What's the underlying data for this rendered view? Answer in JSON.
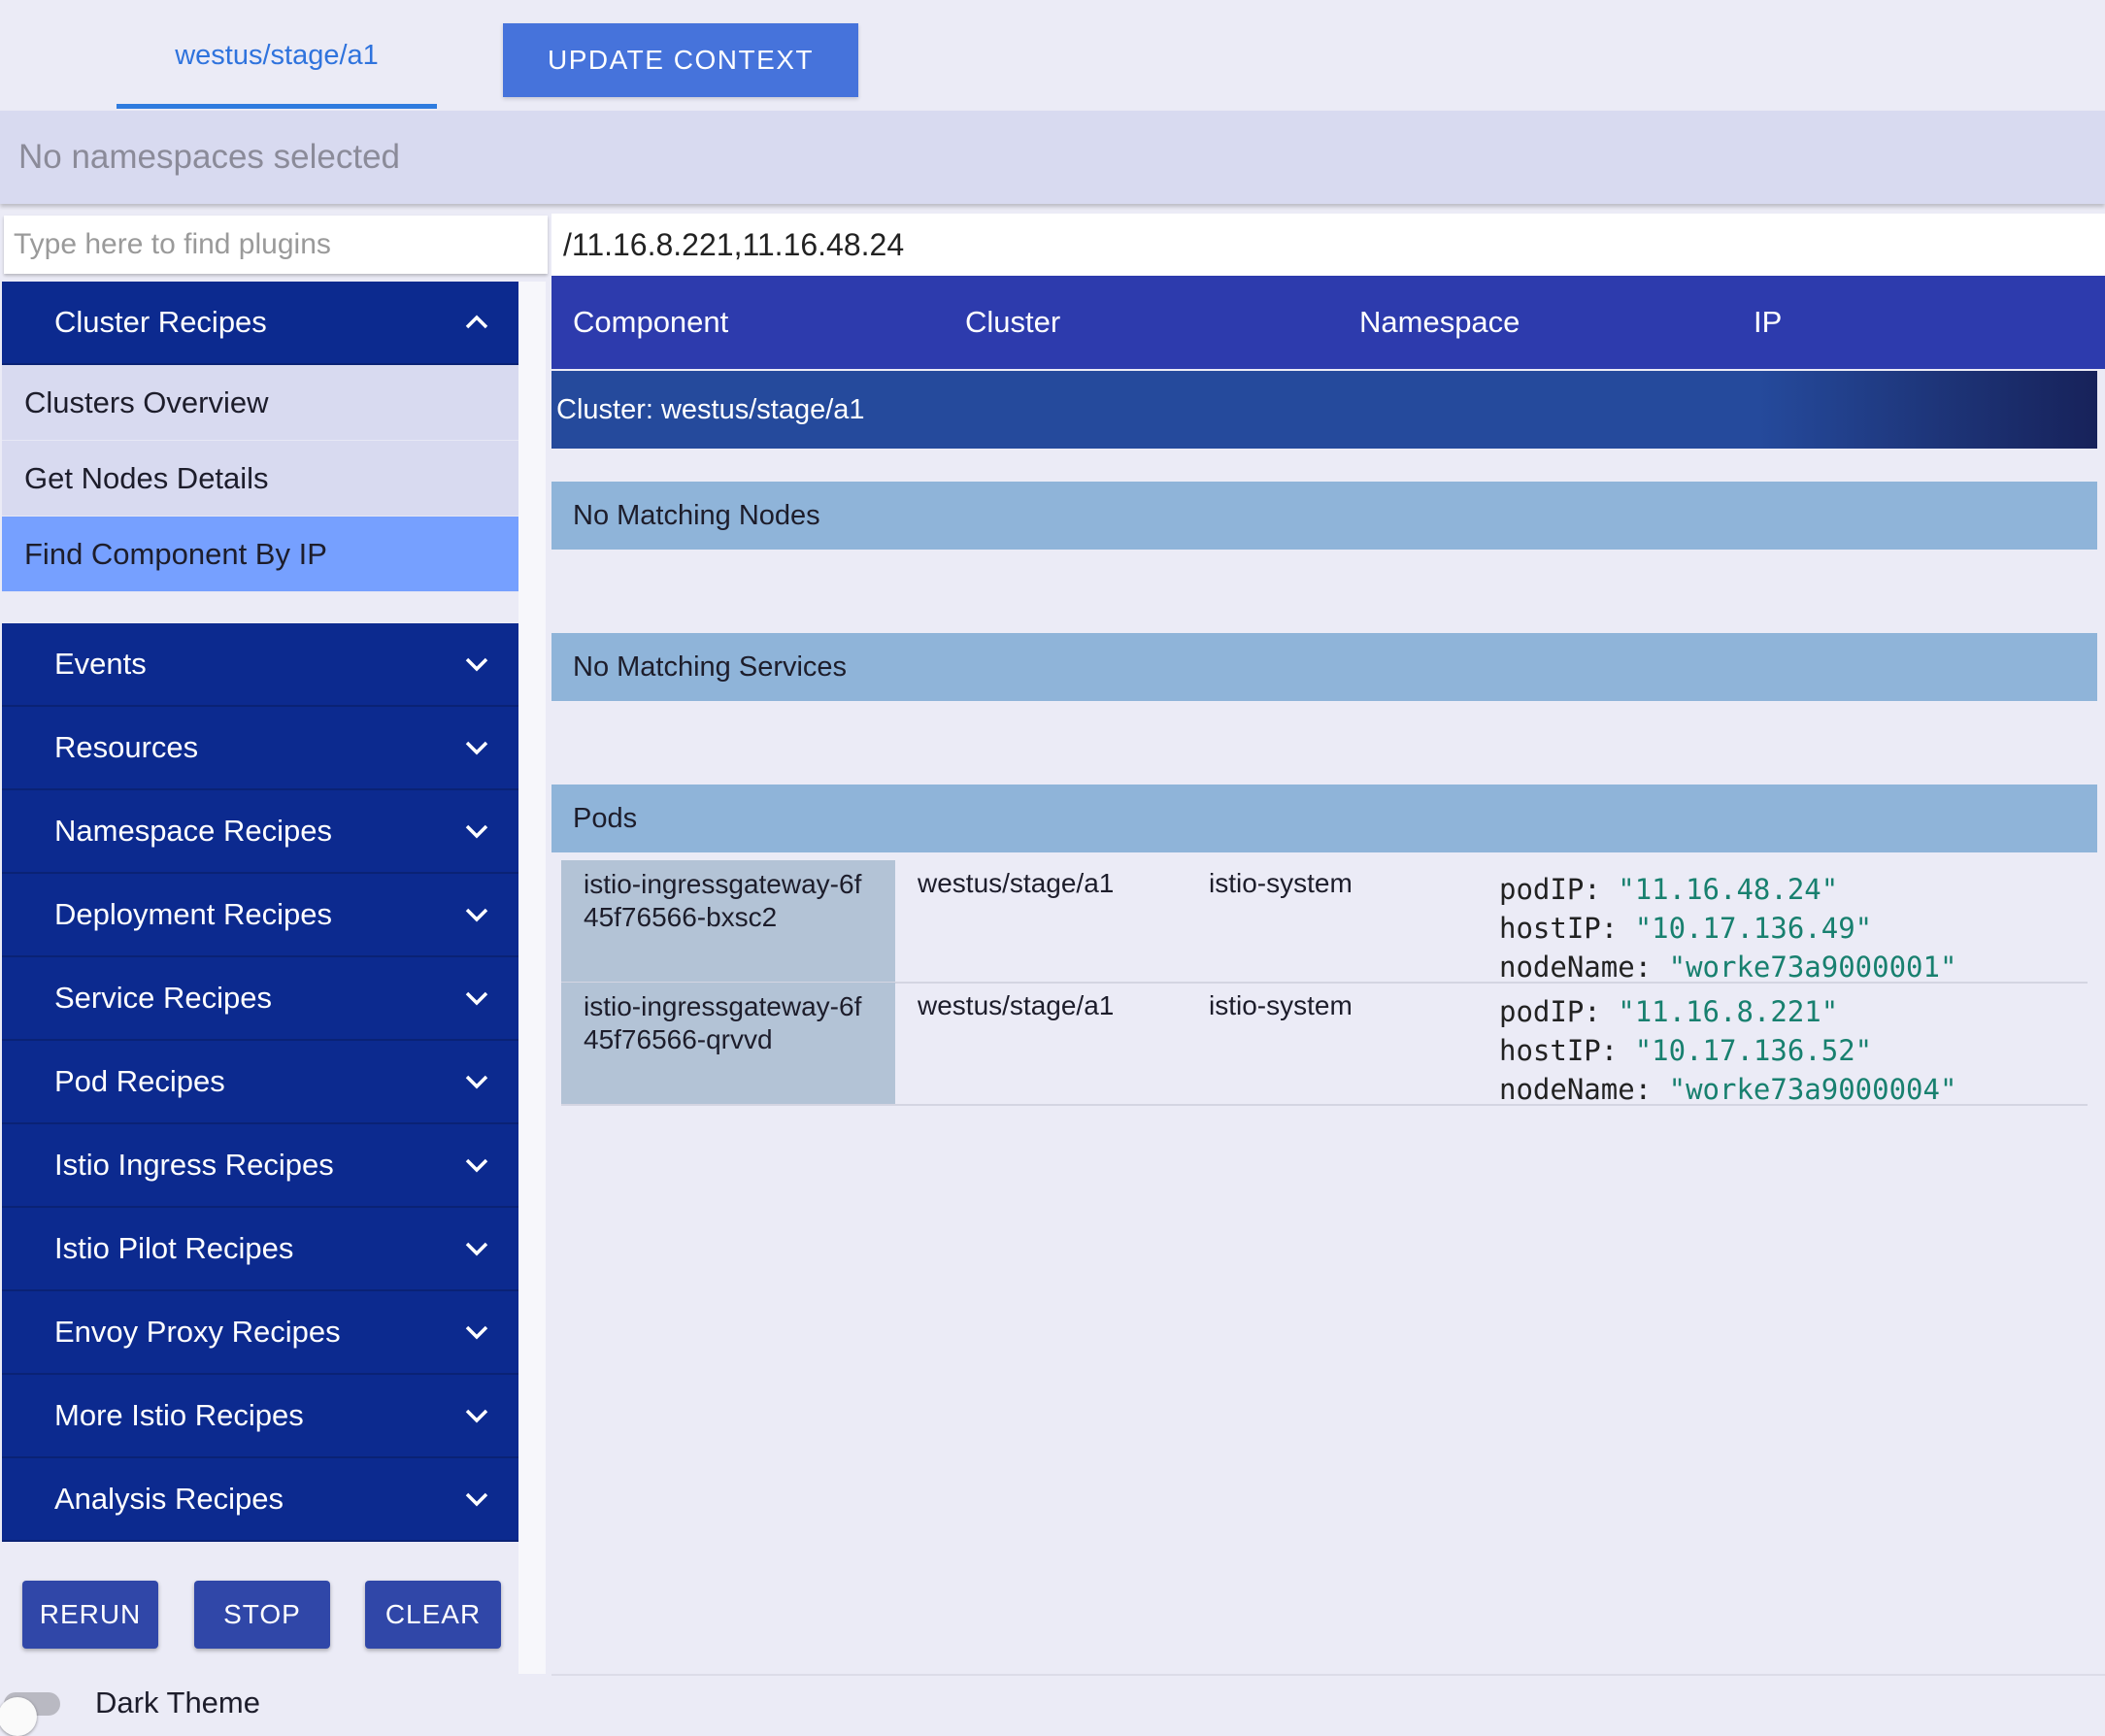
{
  "header": {
    "context_tab": "westus/stage/a1",
    "update_button": "UPDATE CONTEXT",
    "namespace_status": "No namespaces selected"
  },
  "search": {
    "plugin_placeholder": "Type here to find plugins",
    "filter_value": "/11.16.8.221,11.16.48.24"
  },
  "sidebar": {
    "expanded_group": {
      "label": "Cluster Recipes",
      "items": [
        "Clusters Overview",
        "Get Nodes Details",
        "Find Component By IP"
      ],
      "active_item": "Find Component By IP"
    },
    "groups": [
      "Events",
      "Resources",
      "Namespace Recipes",
      "Deployment Recipes",
      "Service Recipes",
      "Pod Recipes",
      "Istio Ingress Recipes",
      "Istio Pilot Recipes",
      "Envoy Proxy Recipes",
      "More Istio Recipes",
      "Analysis Recipes"
    ],
    "actions": {
      "rerun": "RERUN",
      "stop": "STOP",
      "clear": "CLEAR"
    },
    "dark_theme_label": "Dark Theme",
    "dark_theme_on": false
  },
  "results": {
    "columns": [
      "Component",
      "Cluster",
      "Namespace",
      "IP"
    ],
    "cluster_header": "Cluster: westus/stage/a1",
    "sections": {
      "nodes": "No Matching Nodes",
      "services": "No Matching Services",
      "pods": "Pods"
    },
    "pods": [
      {
        "name_line1": "istio-ingressgateway-6f",
        "name_line2": "45f76566-bxsc2",
        "cluster": "westus/stage/a1",
        "namespace": "istio-system",
        "podIP": "\"11.16.48.24\"",
        "hostIP": "\"10.17.136.49\"",
        "nodeName": "\"worke73a9000001\""
      },
      {
        "name_line1": "istio-ingressgateway-6f",
        "name_line2": "45f76566-qrvvd",
        "cluster": "westus/stage/a1",
        "namespace": "istio-system",
        "podIP": "\"11.16.8.221\"",
        "hostIP": "\"10.17.136.52\"",
        "nodeName": "\"worke73a9000004\""
      }
    ],
    "json_keys": {
      "pod_ip": "podIP:",
      "host_ip": "hostIP:",
      "node_name": "nodeName:"
    }
  },
  "colors": {
    "accent": "#4673db",
    "sidebar": "#0c2a8f",
    "active_item": "#76a0ff",
    "table_header": "#2d3bad",
    "section": "#8fb4d9",
    "json_value": "#18806f"
  },
  "icons": {
    "expanded": "chevron-up-icon",
    "collapsed": "chevron-down-icon"
  }
}
